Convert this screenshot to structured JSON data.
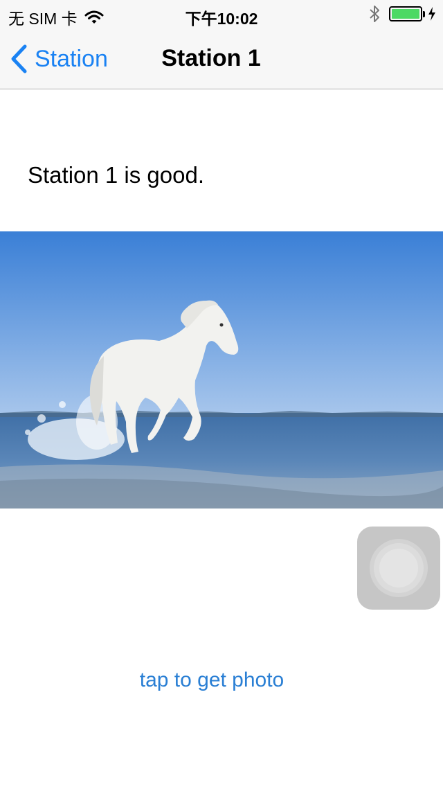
{
  "status_bar": {
    "carrier": "无 SIM 卡",
    "time": "下午10:02",
    "icons": [
      "wifi-icon",
      "bluetooth-icon",
      "battery-icon",
      "charging-bolt-icon"
    ],
    "battery_level": 1.0
  },
  "nav": {
    "back_label": "Station",
    "back_icon": "chevron-left-icon",
    "title": "Station 1"
  },
  "content": {
    "description": "Station 1 is good.",
    "photo_subject": "white-horse-photo",
    "action_link": "tap to get photo"
  },
  "colors": {
    "accent": "#1a82f3",
    "link": "#2a7fd4",
    "battery": "#4cd964",
    "bar_bg": "#f7f7f7"
  }
}
